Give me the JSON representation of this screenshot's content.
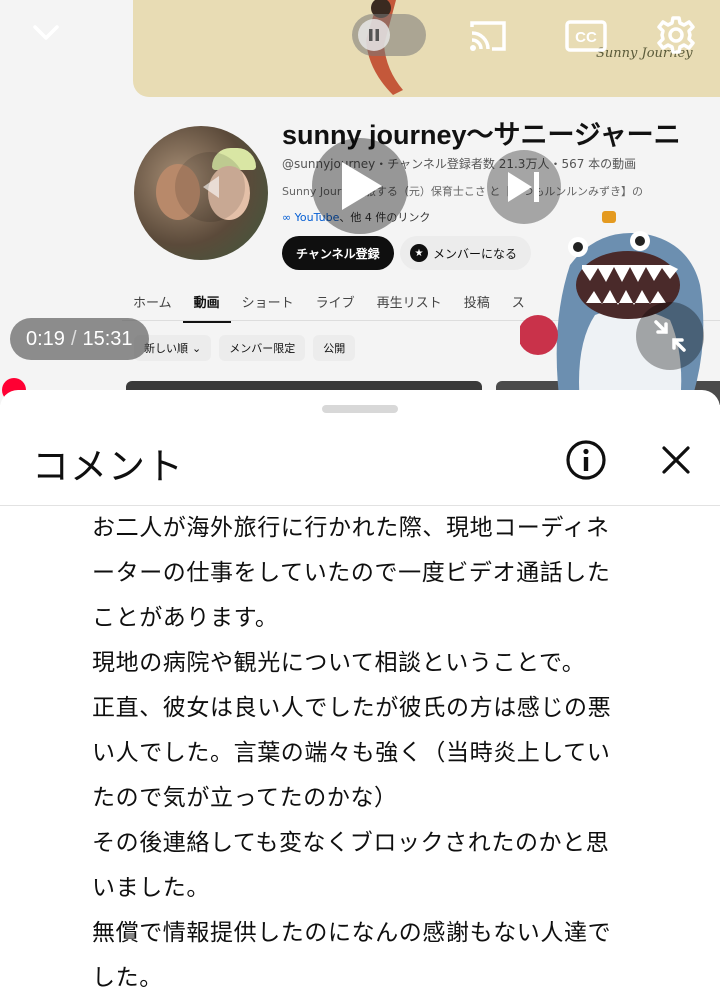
{
  "player": {
    "banner": {
      "logo_text": "Sunny Journey"
    },
    "channel": {
      "title": "sunny journey〜サニージャーニ",
      "meta": "@sunnyjourney・チャンネル登録者数 21.3万人・567 本の動画",
      "description": "Sunny Journey 旅する（元）保育士こさ と【いつもルンルンみずき】の",
      "link_prefix": "YouTube",
      "link_suffix": "、他 4 件のリンク",
      "subscribe_label": "チャンネル登録",
      "member_label": "メンバーになる",
      "tabs": [
        "ホーム",
        "動画",
        "ショート",
        "ライブ",
        "再生リスト",
        "投稿",
        "ス"
      ],
      "active_tab": "動画",
      "chips": [
        "新しい順",
        "メンバー限定",
        "公開"
      ]
    },
    "controls": {
      "current_time": "0:19",
      "separator": "/",
      "duration": "15:31",
      "icons": [
        "chevron-down-icon",
        "pause-icon",
        "cast-icon",
        "closed-captions-icon",
        "settings-gear-icon",
        "play-icon",
        "previous-icon",
        "next-icon",
        "fullscreen-exit-icon"
      ]
    },
    "colors": {
      "scrub": "#ff0033",
      "banner_bg": "#e8dcb4"
    }
  },
  "comments": {
    "title": "コメント",
    "body_lines": [
      "お二人が海外旅行に行かれた際、現地コーディネ",
      "ーターの仕事をしていたので一度ビデオ通話した",
      "ことがあります。",
      "現地の病院や観光について相談ということで。",
      "正直、彼女は良い人でしたが彼氏の方は感じの悪",
      "い人でした。言葉の端々も強く（当時炎上してい",
      "たので気が立ってたのかな）",
      "その後連絡しても変なくブロックされたのかと思",
      "いました。",
      "無償で情報提供したのになんの感謝もない人達で",
      "した。"
    ]
  }
}
